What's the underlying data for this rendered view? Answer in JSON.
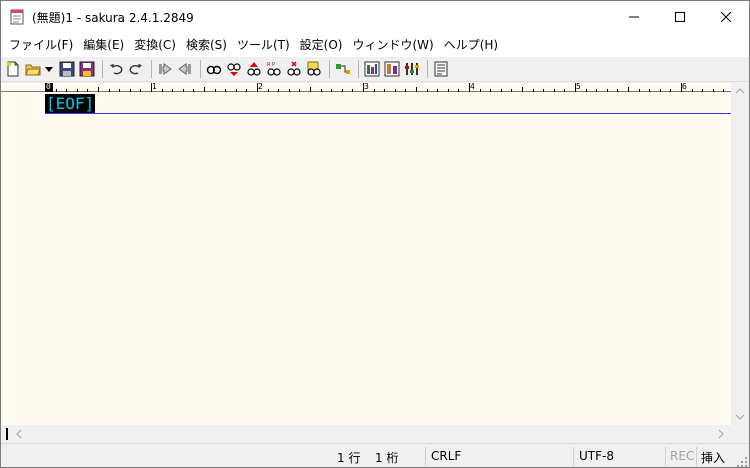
{
  "window": {
    "title": "(無題)1 - sakura 2.4.1.2849",
    "accent": "#000000"
  },
  "menu": [
    {
      "label": "ファイル(F)"
    },
    {
      "label": "編集(E)"
    },
    {
      "label": "変換(C)"
    },
    {
      "label": "検索(S)"
    },
    {
      "label": "ツール(T)"
    },
    {
      "label": "設定(O)"
    },
    {
      "label": "ウィンドウ(W)"
    },
    {
      "label": "ヘルプ(H)"
    }
  ],
  "toolbar": {
    "buttons": [
      {
        "icon": "new-file-icon"
      },
      {
        "icon": "open-folder-icon"
      },
      {
        "icon": "save-icon"
      },
      {
        "icon": "save-all-icon"
      },
      {
        "icon": "undo-icon"
      },
      {
        "icon": "redo-icon"
      },
      {
        "icon": "jump-back-icon"
      },
      {
        "icon": "jump-forward-icon"
      },
      {
        "icon": "find-icon"
      },
      {
        "icon": "find-prev-icon"
      },
      {
        "icon": "find-next-icon"
      },
      {
        "icon": "replace-icon"
      },
      {
        "icon": "clear-highlight-icon"
      },
      {
        "icon": "grep-icon"
      },
      {
        "icon": "outline-icon"
      },
      {
        "icon": "window-list-icon"
      },
      {
        "icon": "compare-icon"
      },
      {
        "icon": "settings-icon"
      },
      {
        "icon": "document-view-icon"
      }
    ]
  },
  "editor": {
    "ruler_labels": [
      "0",
      "1",
      "2",
      "3",
      "4",
      "5",
      "6"
    ],
    "eof_text": "[EOF]",
    "background": "#fffbf0",
    "eof_color": "#00c8e8"
  },
  "status": {
    "line": "1 行",
    "column": "1 桁",
    "line_ending": "CRLF",
    "encoding": "UTF-8",
    "rec": "REC",
    "mode": "挿入"
  }
}
